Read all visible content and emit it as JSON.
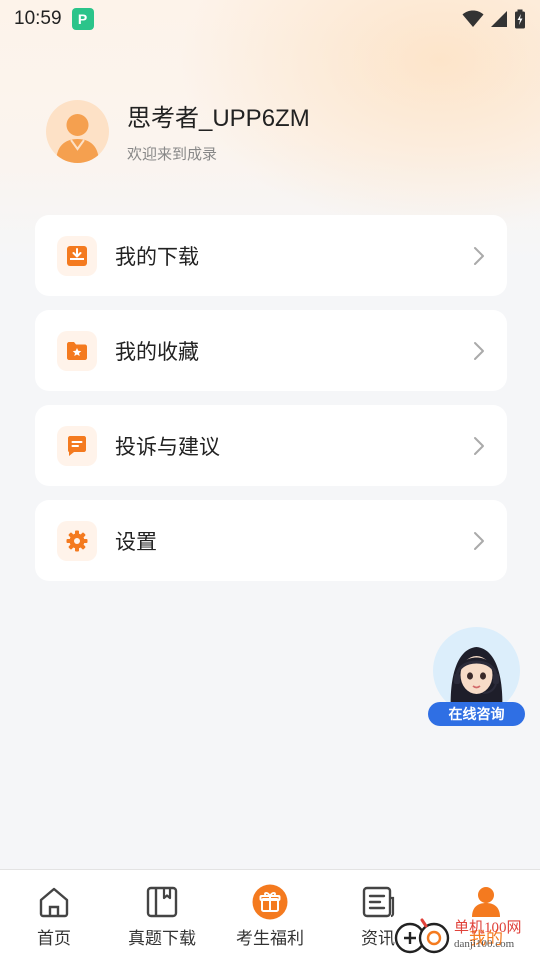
{
  "status_bar": {
    "time": "10:59",
    "app_icon_letter": "P",
    "icons": [
      "wifi-icon",
      "signal-icon",
      "battery-icon"
    ]
  },
  "profile": {
    "username": "思考者_UPP6ZM",
    "welcome": "欢迎来到成录"
  },
  "menu": {
    "items": [
      {
        "label": "我的下载",
        "icon": "download-icon"
      },
      {
        "label": "我的收藏",
        "icon": "favorites-folder-icon"
      },
      {
        "label": "投诉与建议",
        "icon": "feedback-icon"
      },
      {
        "label": "设置",
        "icon": "settings-icon"
      }
    ]
  },
  "consult": {
    "label": "在线咨询"
  },
  "tabbar": {
    "items": [
      {
        "label": "首页",
        "icon": "home-icon",
        "active": false
      },
      {
        "label": "真题下载",
        "icon": "book-icon",
        "active": false
      },
      {
        "label": "考生福利",
        "icon": "gift-icon",
        "active": false
      },
      {
        "label": "资讯",
        "icon": "news-icon",
        "active": false
      },
      {
        "label": "我的",
        "icon": "user-icon",
        "active": true
      }
    ]
  },
  "watermark": {
    "text": "单机100网",
    "sub": "danji100.com"
  },
  "colors": {
    "accent": "#f47a1f",
    "consult_button": "#2f6fe4",
    "background": "#f5f6f8"
  }
}
